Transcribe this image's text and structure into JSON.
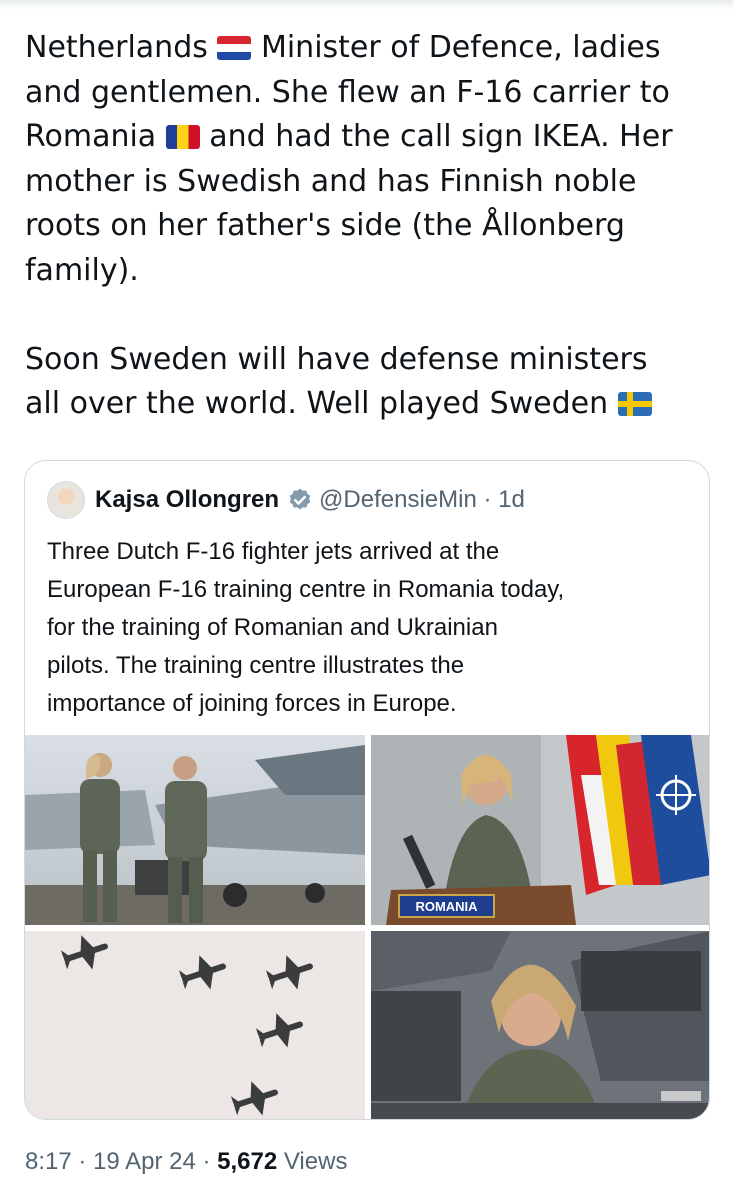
{
  "tweet": {
    "lines": [
      {
        "t1": "Netherlands ",
        "flag": "netherlands-flag-emoji",
        "t2": " Minister of Defence, ladies"
      },
      {
        "t1": "and gentlemen. She flew an F-16 carrier to"
      },
      {
        "t1": "Romania ",
        "flag": "romania-flag-emoji",
        "t2": " and had the call sign IKEA. Her"
      },
      {
        "t1": "mother is Swedish and has Finnish noble"
      },
      {
        "t1": "roots on her father's side (the Ållonberg"
      },
      {
        "t1": "family)."
      },
      {
        "t1": "Soon Sweden will have defense ministers"
      },
      {
        "t1": "all over the world. Well played Sweden ",
        "flag": "sweden-flag-emoji"
      }
    ]
  },
  "quoted": {
    "name": "Kajsa Ollongren",
    "handle": "@DefensieMin",
    "separator": "·",
    "time": "1d",
    "verified_icon": "verified-badge-icon",
    "lines": [
      "Three Dutch F-16 fighter jets arrived at the",
      "European F-16 training centre in Romania today,",
      "for the training of Romanian and Ukrainian",
      "pilots. The training centre illustrates the",
      "importance of joining forces in Europe."
    ],
    "photo_text": {
      "podium_sign": "ROMANIA"
    }
  },
  "meta": {
    "time": "8:17",
    "sep1": " · ",
    "date": "19 Apr 24",
    "sep2": " · ",
    "views_count": "5,672",
    "views_label": " Views"
  },
  "colors": {
    "text": "#0f1419",
    "secondary": "#536471",
    "border": "#cfd9de",
    "verified": "#829aab"
  }
}
